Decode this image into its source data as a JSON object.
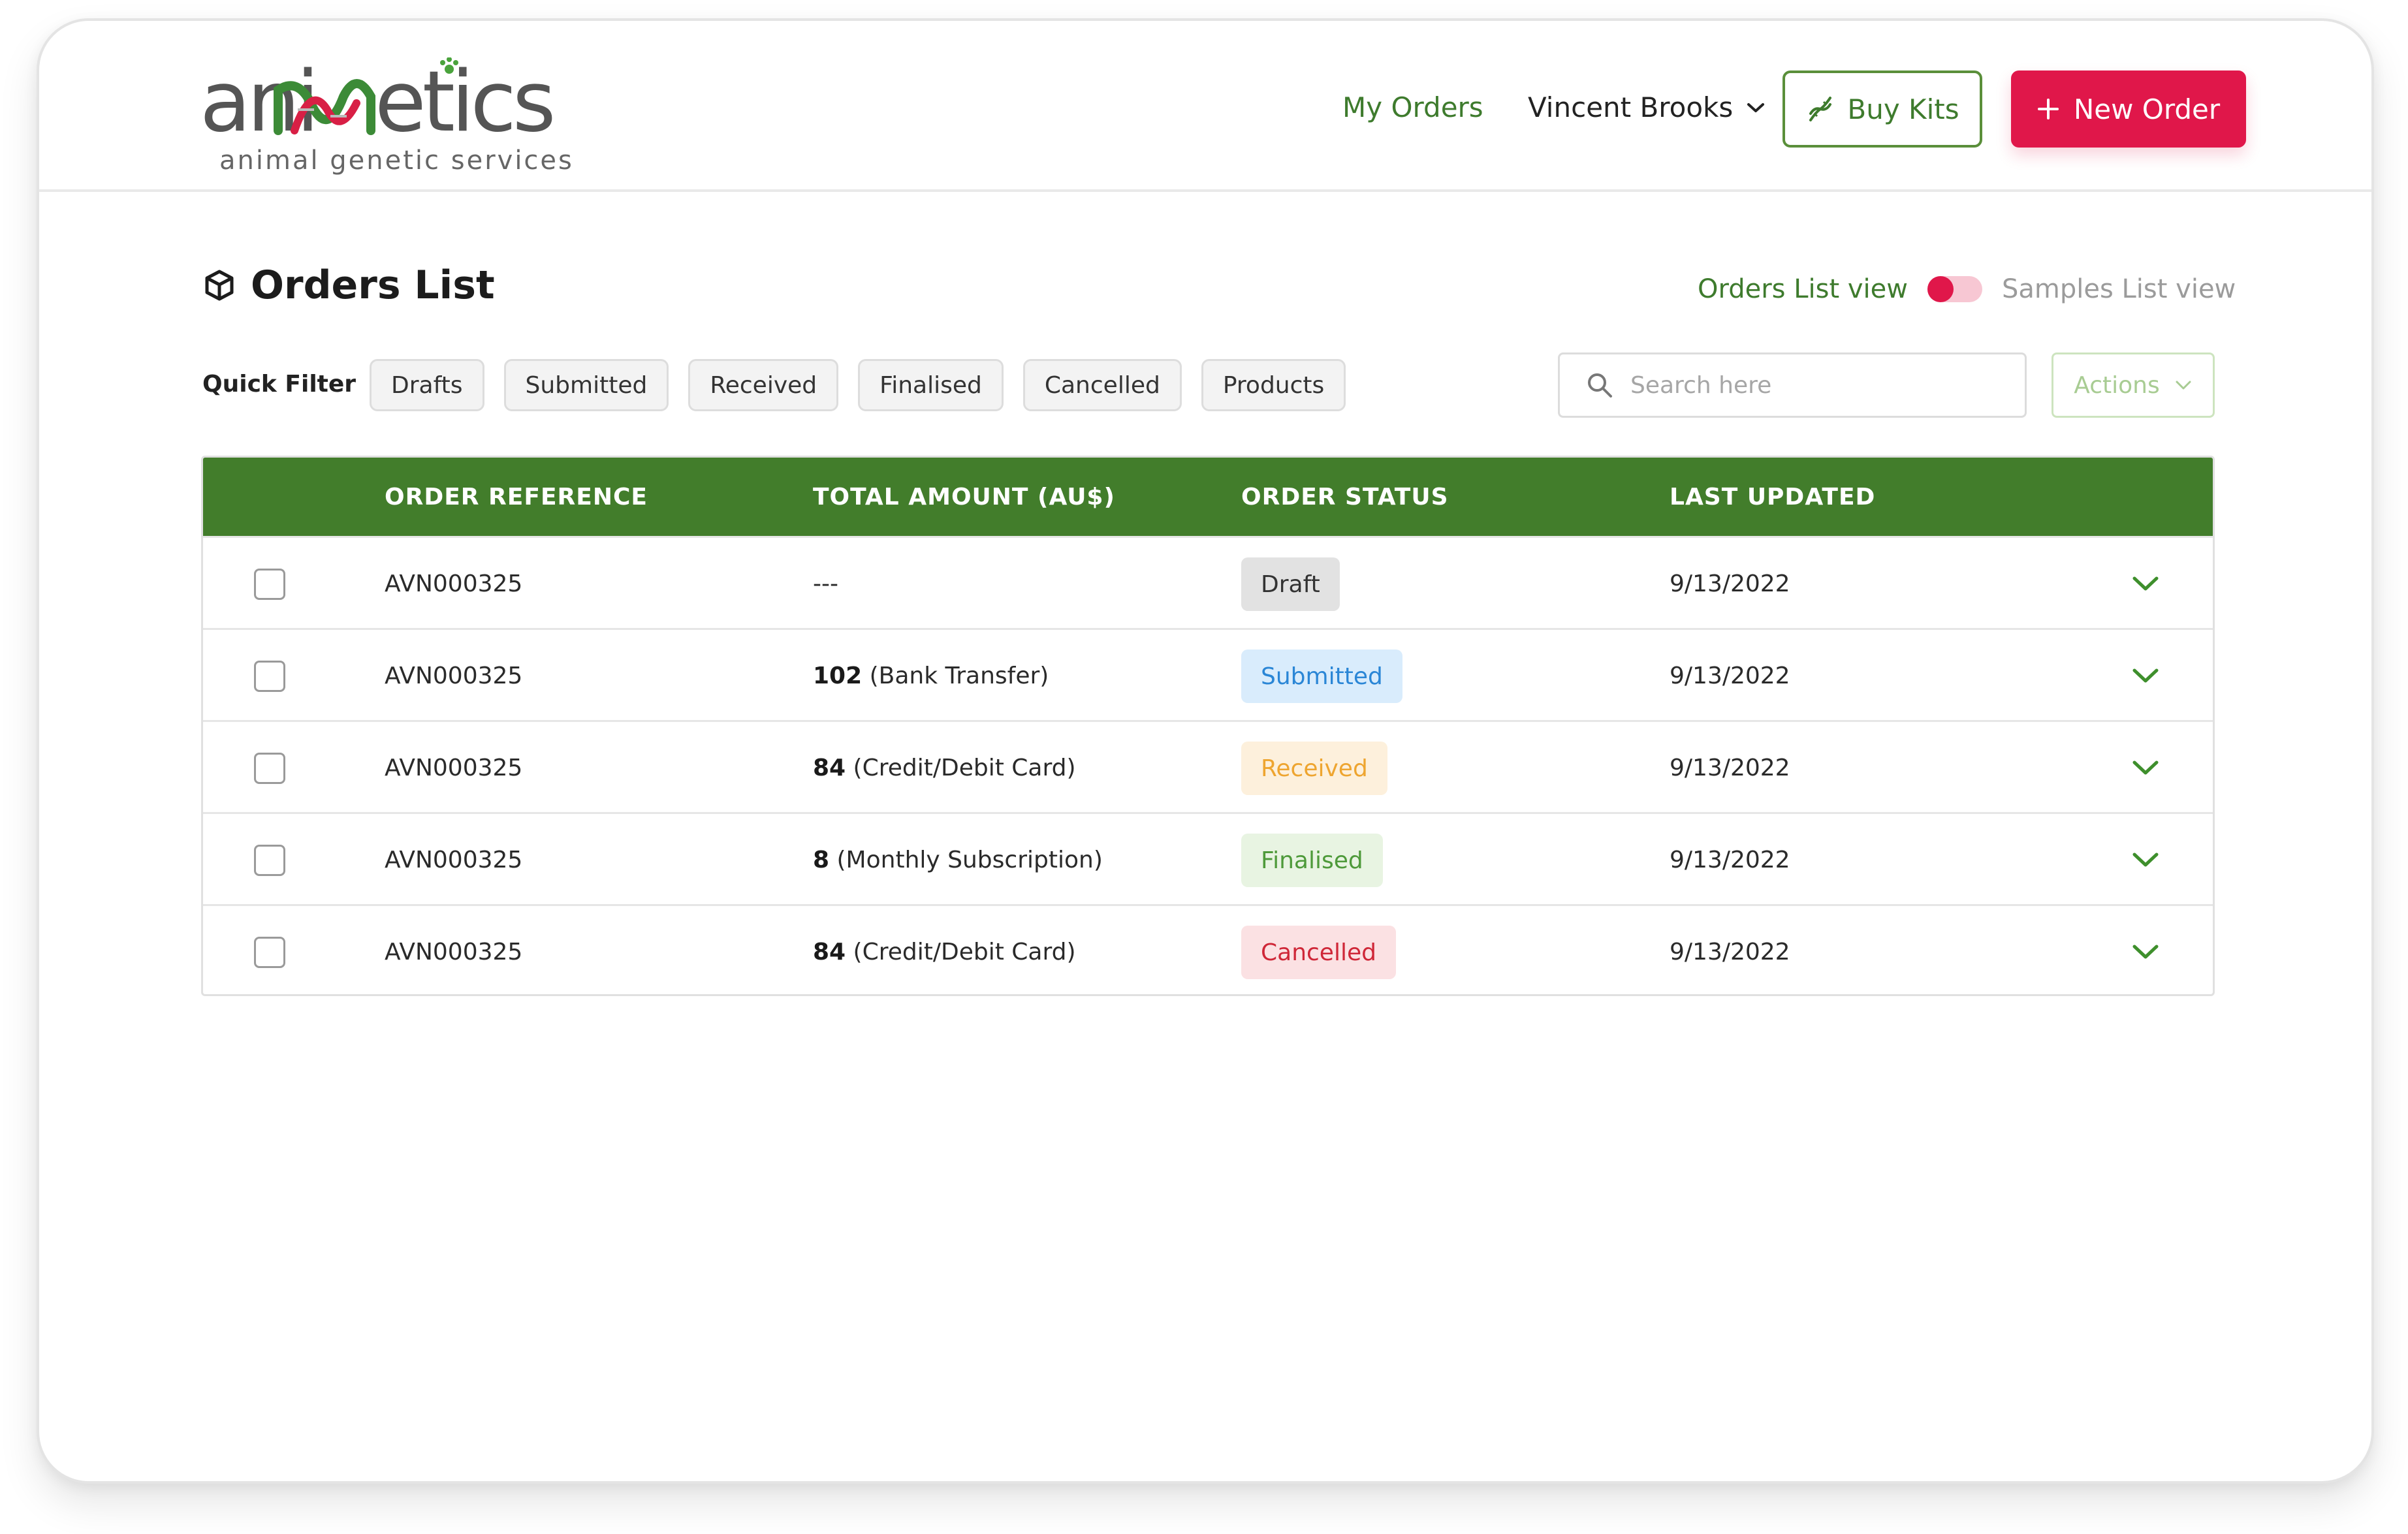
{
  "brand": {
    "word": "animmetics",
    "tagline": "animal genetic services",
    "accent": "#3e7b2d",
    "primary": "#e0174a"
  },
  "header": {
    "nav_my_orders": "My Orders",
    "user_name": "Vincent Brooks",
    "buy_kits": "Buy Kits",
    "new_order": "New Order"
  },
  "page": {
    "title": "Orders List",
    "view_orders": "Orders List view",
    "view_samples": "Samples List view"
  },
  "filters": {
    "label": "Quick Filter",
    "chips": [
      "Drafts",
      "Submitted",
      "Received",
      "Finalised",
      "Cancelled",
      "Products"
    ]
  },
  "search": {
    "placeholder": "Search here"
  },
  "actions": {
    "label": "Actions"
  },
  "table": {
    "header_color": "#427d2b",
    "columns": [
      "ORDER REFERENCE",
      "TOTAL AMOUNT (AU$)",
      "ORDER STATUS",
      "LAST UPDATED"
    ],
    "rows": [
      {
        "ref": "AVN000325",
        "amount": "",
        "method": "---",
        "status": "Draft",
        "updated": "9/13/2022"
      },
      {
        "ref": "AVN000325",
        "amount": "102",
        "method": " (Bank Transfer)",
        "status": "Submitted",
        "updated": "9/13/2022"
      },
      {
        "ref": "AVN000325",
        "amount": "84",
        "method": " (Credit/Debit Card)",
        "status": "Received",
        "updated": "9/13/2022"
      },
      {
        "ref": "AVN000325",
        "amount": "8",
        "method": " (Monthly Subscription)",
        "status": "Finalised",
        "updated": "9/13/2022"
      },
      {
        "ref": "AVN000325",
        "amount": "84",
        "method": " (Credit/Debit Card)",
        "status": "Cancelled",
        "updated": "9/13/2022"
      }
    ]
  }
}
